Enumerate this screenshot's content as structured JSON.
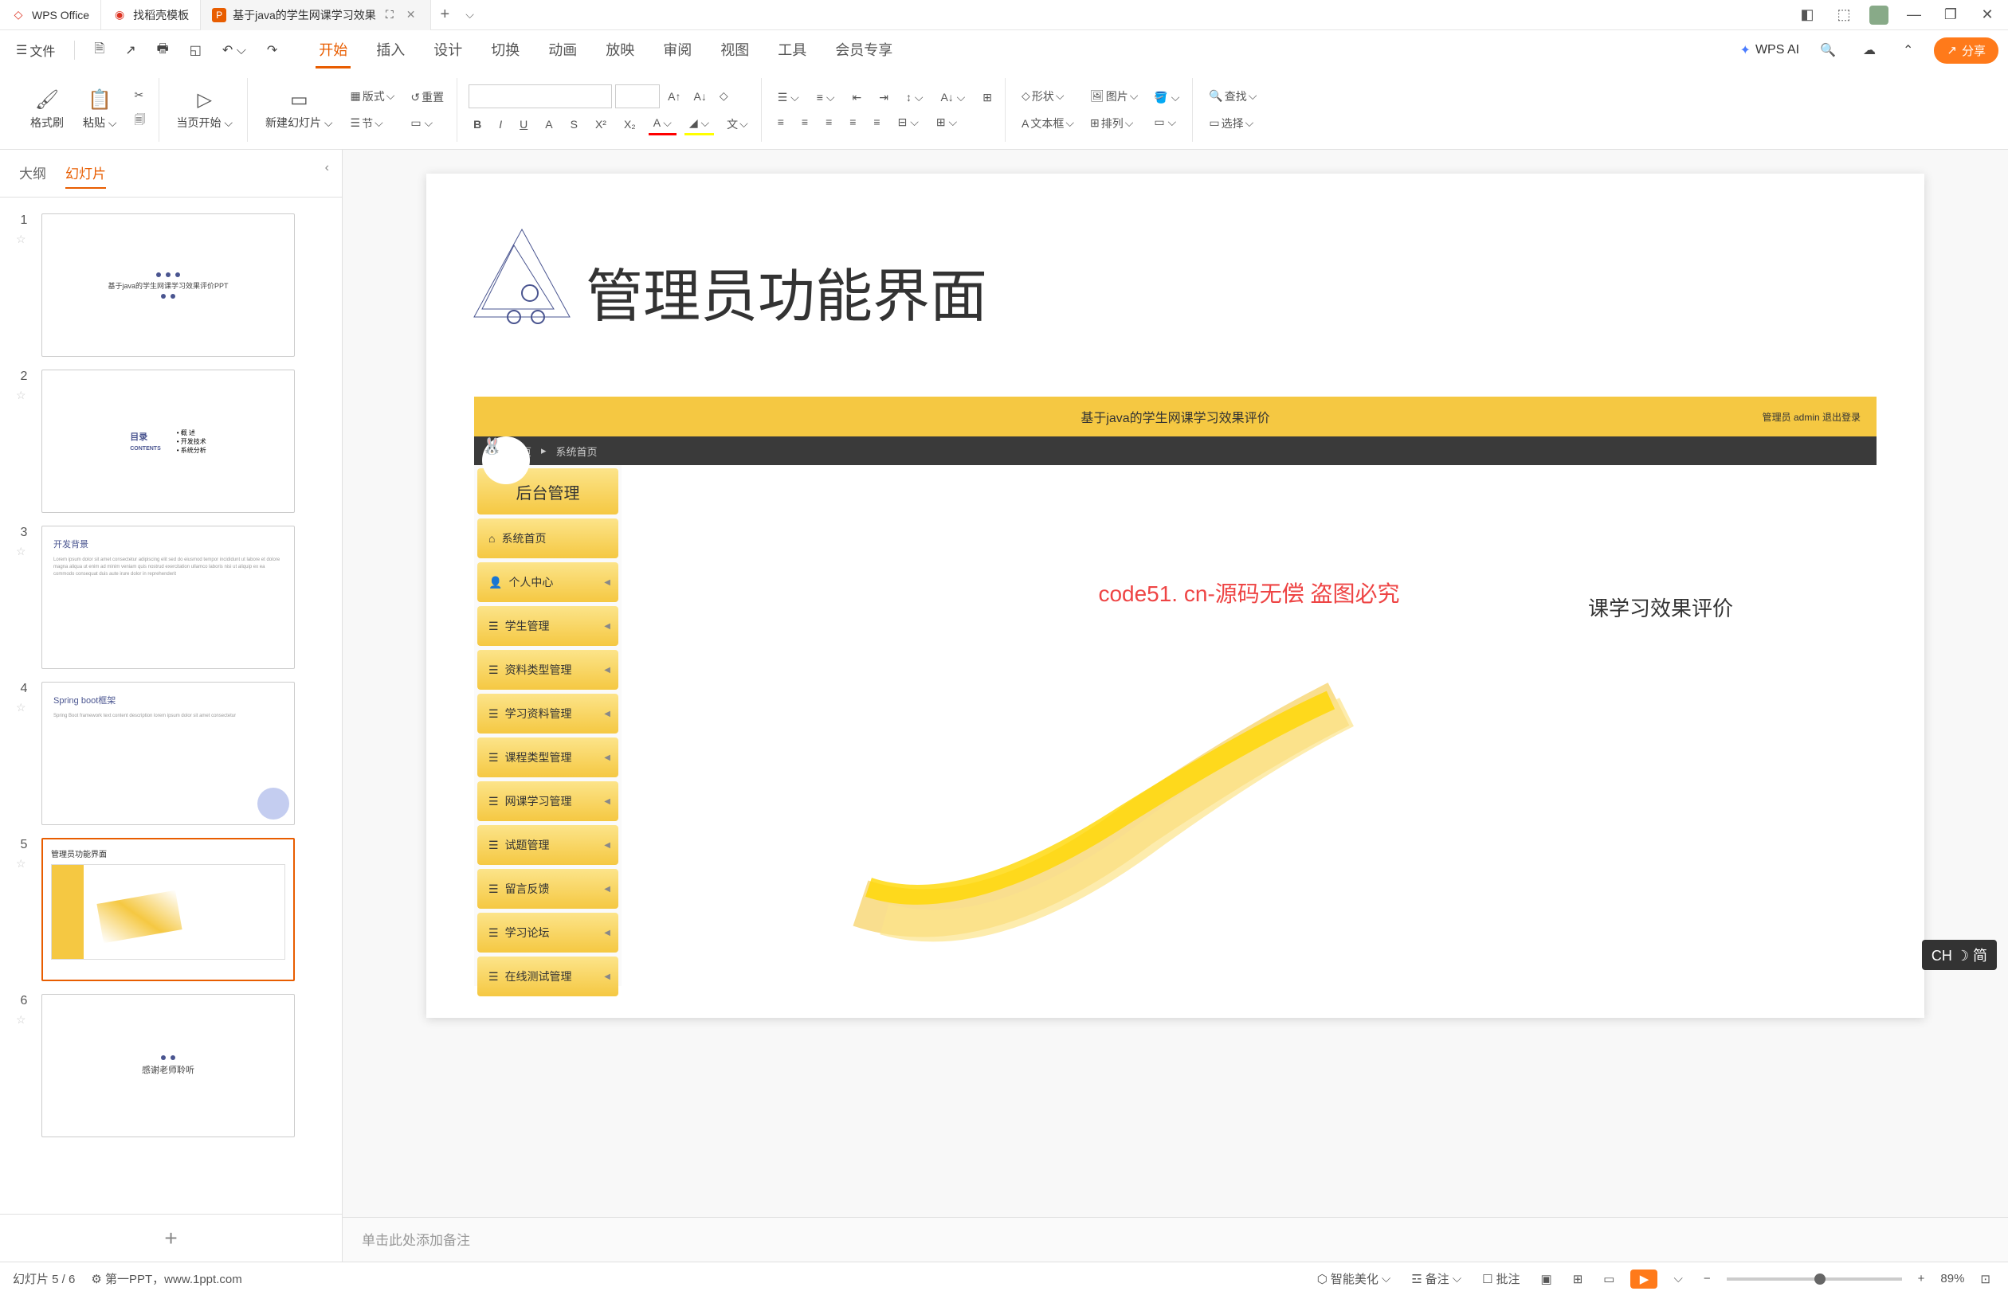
{
  "titlebar": {
    "app_name": "WPS Office",
    "tabs": [
      {
        "label": "找稻壳模板",
        "icon": "template-icon"
      },
      {
        "label": "基于java的学生网课学习效果",
        "icon": "ppt-icon",
        "active": true
      }
    ],
    "window_controls": [
      "layout",
      "3d",
      "user",
      "min",
      "restore",
      "close"
    ]
  },
  "menubar": {
    "file_label": "文件",
    "tabs": [
      "开始",
      "插入",
      "设计",
      "切换",
      "动画",
      "放映",
      "审阅",
      "视图",
      "工具",
      "会员专享"
    ],
    "active_tab": "开始",
    "wps_ai_label": "WPS AI",
    "share_label": "分享"
  },
  "toolbar": {
    "format_painter": "格式刷",
    "paste": "粘贴",
    "from_current": "当页开始",
    "new_slide": "新建幻灯片",
    "layout": "版式",
    "section": "节",
    "reset": "重置",
    "font_name": "",
    "font_size": "",
    "shape": "形状",
    "picture": "图片",
    "text_box": "文本框",
    "arrange": "排列",
    "find": "查找",
    "select": "选择",
    "character": "文"
  },
  "slide_panel": {
    "tab_outline": "大纲",
    "tab_slides": "幻灯片",
    "active_tab": "幻灯片",
    "slides": [
      {
        "num": 1,
        "title": "基于java的学生网课学习效果评价PPT"
      },
      {
        "num": 2,
        "title": "目录 CONTENTS",
        "items": [
          "概 述",
          "开发技术",
          "系统分析"
        ]
      },
      {
        "num": 3,
        "title": "开发背景"
      },
      {
        "num": 4,
        "title": "Spring boot框架"
      },
      {
        "num": 5,
        "title": "管理员功能界面",
        "selected": true
      },
      {
        "num": 6,
        "title": "感谢老师聆听"
      }
    ]
  },
  "current_slide": {
    "title": "管理员功能界面",
    "screenshot": {
      "header_title": "基于java的学生网课学习效果评价",
      "header_user": "管理员 admin  退出登录",
      "breadcrumb": [
        "系统首页",
        "系统首页"
      ],
      "sidebar_title": "后台管理",
      "sidebar_items": [
        "系统首页",
        "个人中心",
        "学生管理",
        "资料类型管理",
        "学习资料管理",
        "课程类型管理",
        "网课学习管理",
        "试题管理",
        "留言反馈",
        "学习论坛",
        "在线测试管理"
      ],
      "welcome_text": "课学习效果评价",
      "red_watermark": "code51. cn-源码无偿 盗图必究"
    }
  },
  "notes": {
    "placeholder": "单击此处添加备注"
  },
  "statusbar": {
    "slide_info": "幻灯片 5 / 6",
    "author_info": "第一PPT，www.1ppt.com",
    "smart_beautify": "智能美化",
    "notes_btn": "备注",
    "comments_btn": "批注",
    "zoom_pct": "89%"
  },
  "watermark_text": "code51.cn",
  "ime_badge": "CH ☽ 简"
}
